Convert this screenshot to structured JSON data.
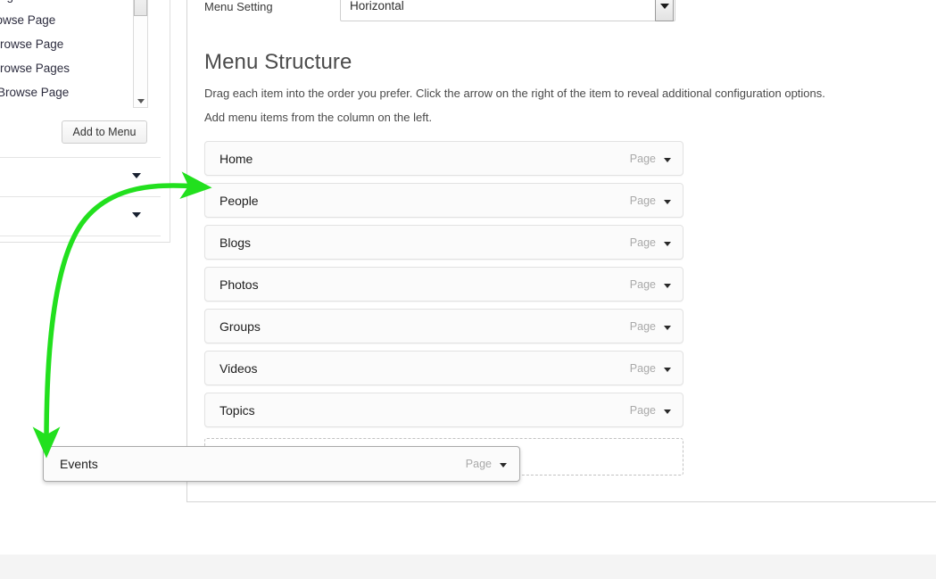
{
  "setting": {
    "label": "Menu Setting",
    "select_value": "Horizontal",
    "select_options": [
      "Horizontal"
    ],
    "caret_icon": "chevron-down-icon"
  },
  "section": {
    "title": "Menu Structure",
    "help_line_1": "Drag each item into the order you prefer. Click the arrow on the right of the item to reveal additional configuration options.",
    "help_line_2": "Add menu items from the column on the left."
  },
  "menu_items": [
    {
      "label": "Home",
      "type": "Page"
    },
    {
      "label": "People",
      "type": "Page"
    },
    {
      "label": "Blogs",
      "type": "Page"
    },
    {
      "label": "Photos",
      "type": "Page"
    },
    {
      "label": "Groups",
      "type": "Page"
    },
    {
      "label": "Videos",
      "type": "Page"
    },
    {
      "label": "Topics",
      "type": "Page"
    }
  ],
  "dragged_item": {
    "label": "Events",
    "type": "Page"
  },
  "sidebar": {
    "pick_list": [
      {
        "label": "Page"
      },
      {
        "label": "rowse Page"
      },
      {
        "label": "Browse Page"
      },
      {
        "label": "Browse Pages"
      },
      {
        "label": "Browse Page"
      }
    ],
    "add_button": "Add to Menu",
    "scrollbar_down_icon": "chevron-down-icon",
    "accordion_caret_icon": "chevron-down-icon"
  },
  "annotation": {
    "arrow_color": "#22e01e",
    "type": "curved-drag-arrow"
  }
}
